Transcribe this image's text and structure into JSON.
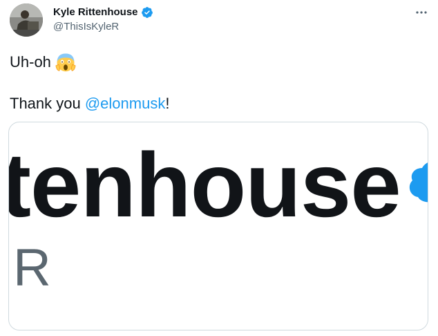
{
  "author": {
    "display_name": "Kyle Rittenhouse",
    "handle": "@ThisIsKyleR",
    "verified": true
  },
  "tweet": {
    "line1_text": "Uh-oh",
    "line1_emoji": "face-screaming-in-fear-emoji",
    "line2_prefix": "Thank you ",
    "line2_mention": "@elonmusk",
    "line2_suffix": "!"
  },
  "media": {
    "large_text": "tenhouse",
    "small_text": "R"
  },
  "colors": {
    "link": "#1d9bf0",
    "verified": "#1d9bf0",
    "text": "#0f1419",
    "secondary": "#536471"
  },
  "icons": {
    "more": "more-horizontal-icon",
    "verified": "verified-badge-icon"
  }
}
